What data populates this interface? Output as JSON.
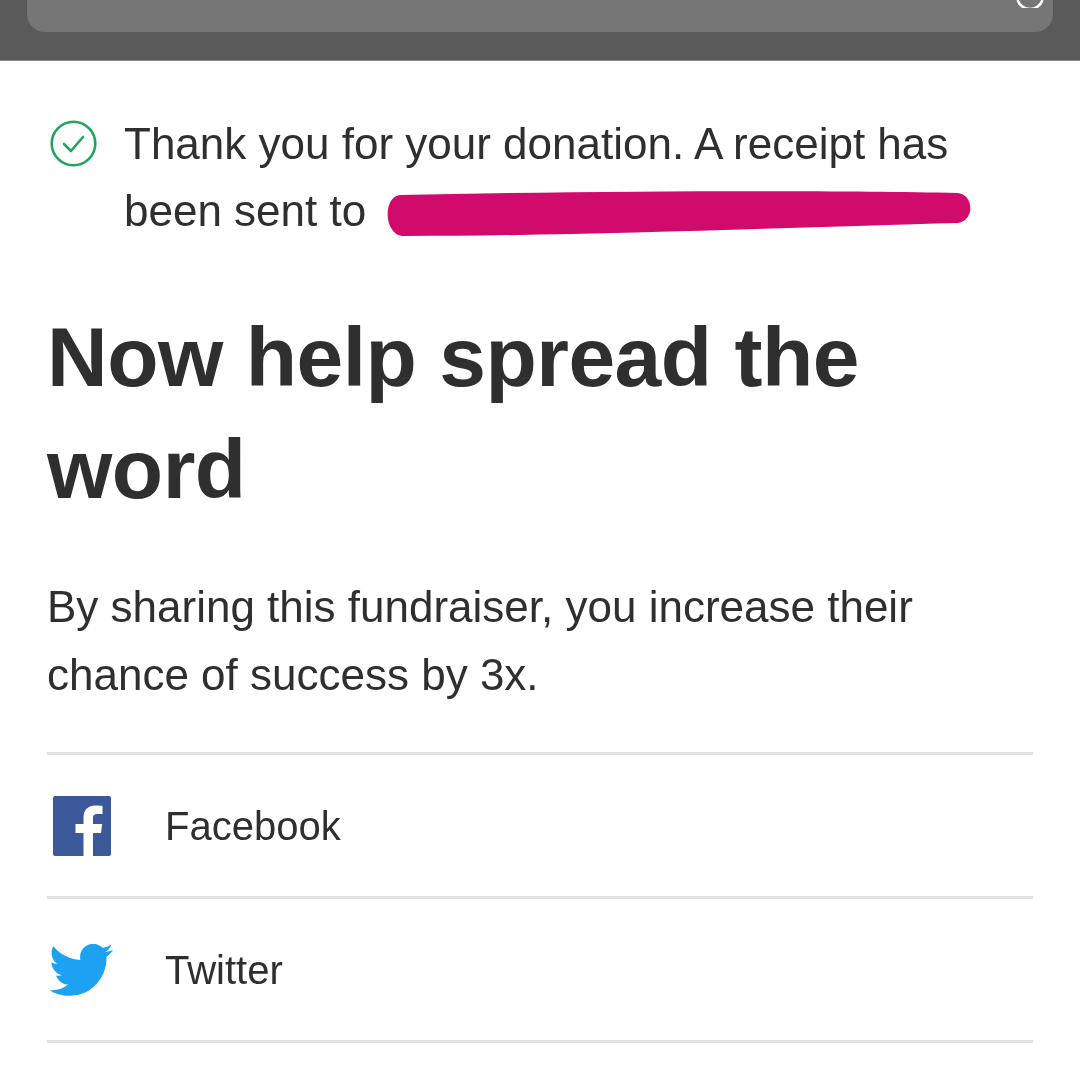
{
  "notice": {
    "kind": "success",
    "text": "Thank you for your donation. A receipt has been sent to",
    "email_redacted": true
  },
  "heading": "Now help spread the word",
  "description": "By sharing this fundraiser, you increase their chance of success by 3x.",
  "share_options": [
    {
      "kind": "facebook",
      "label": "Facebook"
    },
    {
      "kind": "twitter",
      "label": "Twitter"
    }
  ]
}
